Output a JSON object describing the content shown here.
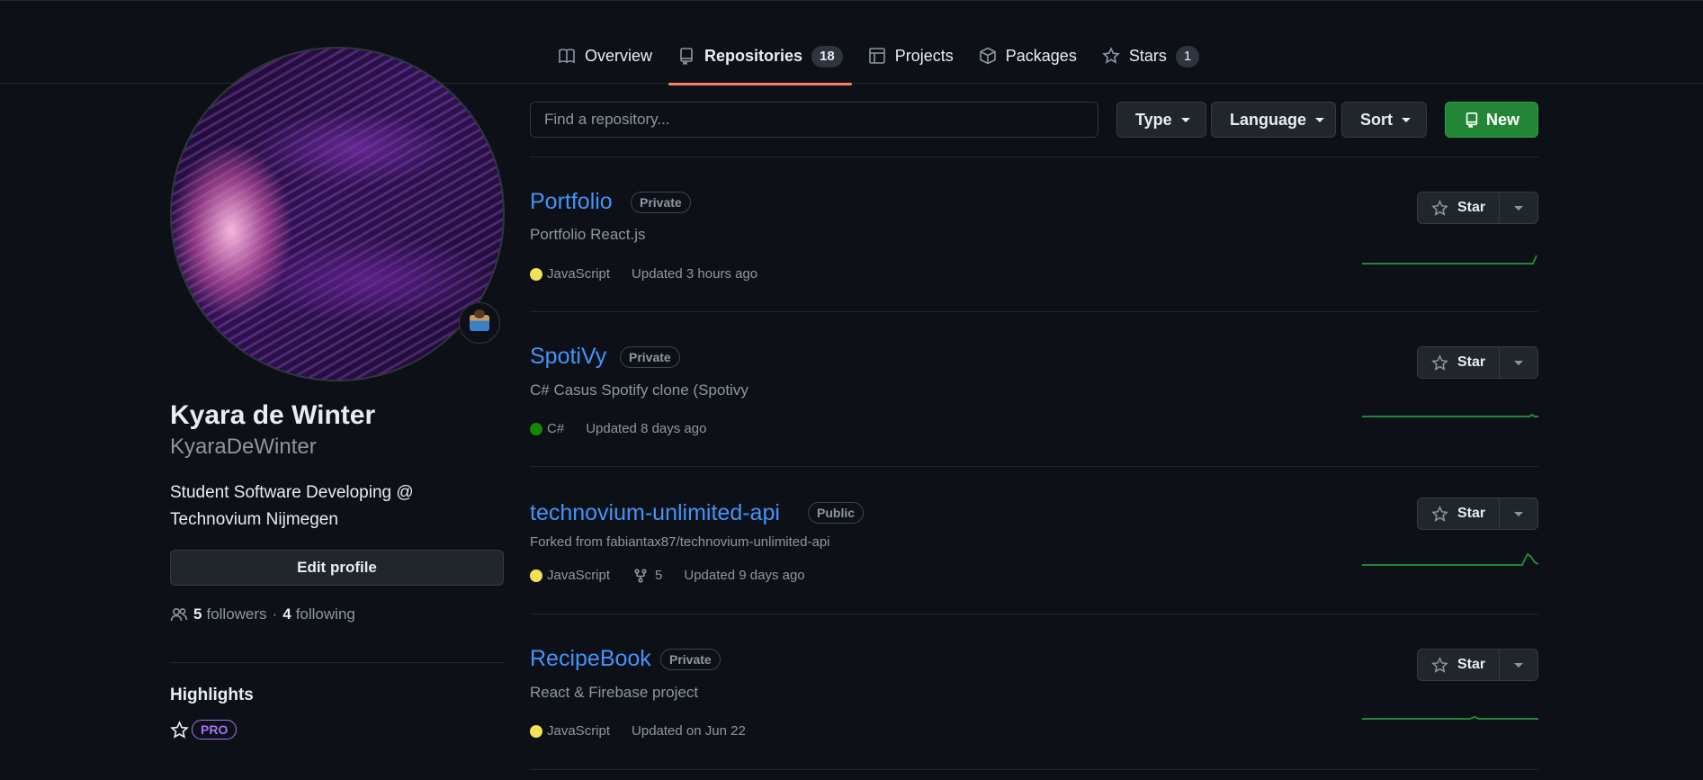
{
  "nav": {
    "tabs": [
      {
        "label": "Overview",
        "icon": "book-icon",
        "count": ""
      },
      {
        "label": "Repositories",
        "icon": "repo-icon",
        "count": "18"
      },
      {
        "label": "Projects",
        "icon": "table-icon",
        "count": ""
      },
      {
        "label": "Packages",
        "icon": "package-icon",
        "count": ""
      },
      {
        "label": "Stars",
        "icon": "star-icon",
        "count": "1"
      }
    ]
  },
  "profile": {
    "full_name": "Kyara de Winter",
    "username": "KyaraDeWinter",
    "bio": "Student Software Developing @ Technovium Nijmegen",
    "edit_label": "Edit profile",
    "followers_count": "5",
    "followers_label": "followers",
    "separator": "·",
    "following_count": "4",
    "following_label": "following",
    "highlights_title": "Highlights",
    "pro_badge": "PRO"
  },
  "filters": {
    "search_placeholder": "Find a repository...",
    "type_label": "Type",
    "language_label": "Language",
    "sort_label": "Sort",
    "new_label": "New"
  },
  "colors": {
    "accent_link": "#4493f8",
    "new_button": "#238636",
    "tab_underline": "#f78166",
    "javascript": "#f1e05a",
    "csharp": "#178600",
    "pro": "#a371f7"
  },
  "repos": [
    {
      "name": "Portfolio",
      "visibility": "Private",
      "description": "Portfolio React.js",
      "forked_from_prefix": "",
      "forked_from": "",
      "language": "JavaScript",
      "forks": "",
      "updated": "Updated 3 hours ago",
      "star_label": "Star"
    },
    {
      "name": "SpotiVy",
      "visibility": "Private",
      "description": "C# Casus Spotify clone (Spotivy",
      "forked_from_prefix": "",
      "forked_from": "",
      "language": "C#",
      "forks": "",
      "updated": "Updated 8 days ago",
      "star_label": "Star"
    },
    {
      "name": "technovium-unlimited-api",
      "visibility": "Public",
      "description": "",
      "forked_from_prefix": "Forked from ",
      "forked_from": "fabiantax87/technovium-unlimited-api",
      "language": "JavaScript",
      "forks": "5",
      "updated": "Updated 9 days ago",
      "star_label": "Star"
    },
    {
      "name": "RecipeBook",
      "visibility": "Private",
      "description": "React & Firebase project",
      "forked_from_prefix": "",
      "forked_from": "",
      "language": "JavaScript",
      "forks": "",
      "updated": "Updated on Jun 22",
      "star_label": "Star"
    }
  ]
}
